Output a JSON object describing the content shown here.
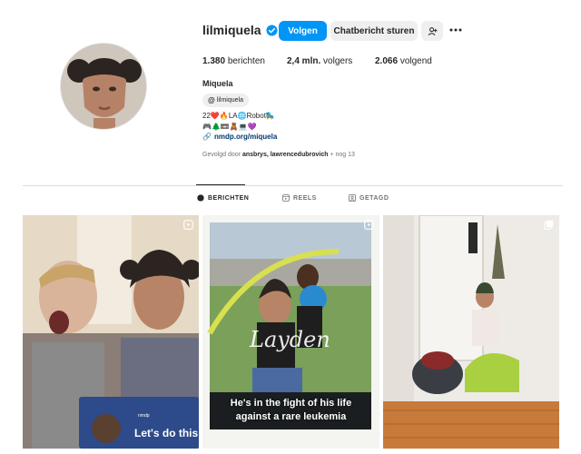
{
  "profile": {
    "username": "lilmiquela",
    "full_name": "Miquela",
    "threads_handle": "lilmiquela",
    "bio_line1": "22❤️🔥LA🌐Robot🛼",
    "bio_line2": "🎮🌲📼🧸💻💜",
    "link": "nmdp.org/miquela"
  },
  "actions": {
    "follow_label": "Volgen",
    "message_label": "Chatbericht sturen",
    "add_icon": "person-add-icon",
    "more_icon": "more-horizontal-icon"
  },
  "stats": {
    "posts_count": "1.380",
    "posts_label": "berichten",
    "followers_count": "2,4 mln.",
    "followers_label": "volgers",
    "following_count": "2.066",
    "following_label": "volgend"
  },
  "followed_by": {
    "prefix": "Gevolgd door",
    "names": "ansbrys, lawrencedubrovich",
    "suffix": "+ nog 13"
  },
  "tabs": [
    {
      "label": "BERICHTEN",
      "icon": "grid-icon",
      "active": true
    },
    {
      "label": "REELS",
      "icon": "reels-icon",
      "active": false
    },
    {
      "label": "GETAGD",
      "icon": "tagged-icon",
      "active": false
    }
  ],
  "posts": [
    {
      "card_brand": "nmdp",
      "card_text": "Let's do this",
      "icon": "reel-icon"
    },
    {
      "caption_line1": "He's in the fight of his life",
      "caption_line2": "against a rare leukemia",
      "script_name": "Layden",
      "icon": "reel-icon"
    },
    {
      "icon": "carousel-icon"
    }
  ],
  "colors": {
    "accent": "#0095f6",
    "button_gray": "#efefef",
    "link": "#00376b",
    "muted": "#737373"
  }
}
